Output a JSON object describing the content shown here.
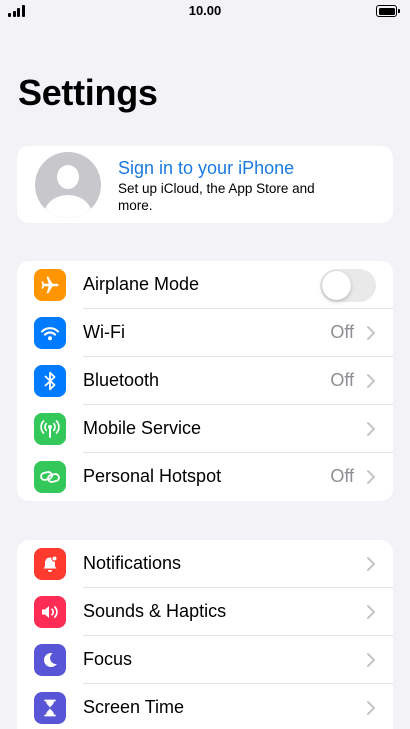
{
  "status_bar": {
    "time": "10.00",
    "signal_icon": "cellular-signal-icon",
    "battery_icon": "battery-full-icon"
  },
  "page": {
    "title": "Settings"
  },
  "profile": {
    "title": "Sign in to your iPhone",
    "subtitle": "Set up iCloud, the App Store and more.",
    "avatar_icon": "person-silhouette-icon",
    "title_color": "#1a7ae0"
  },
  "groups": [
    {
      "rows": [
        {
          "label": "Airplane Mode",
          "icon": "airplane-icon",
          "icon_color": "#ff9500",
          "control": "toggle",
          "toggle_on": false
        },
        {
          "label": "Wi-Fi",
          "icon": "wifi-icon",
          "icon_color": "#007aff",
          "value": "Off"
        },
        {
          "label": "Bluetooth",
          "icon": "bluetooth-icon",
          "icon_color": "#007aff",
          "value": "Off"
        },
        {
          "label": "Mobile Service",
          "icon": "antenna-icon",
          "icon_color": "#34c759",
          "value": ""
        },
        {
          "label": "Personal Hotspot",
          "icon": "hotspot-link-icon",
          "icon_color": "#34c759",
          "value": "Off"
        }
      ]
    },
    {
      "rows": [
        {
          "label": "Notifications",
          "icon": "bell-icon",
          "icon_color": "#ff3b30",
          "value": ""
        },
        {
          "label": "Sounds & Haptics",
          "icon": "speaker-icon",
          "icon_color": "#ff2d55",
          "value": ""
        },
        {
          "label": "Focus",
          "icon": "moon-icon",
          "icon_color": "#5856d6",
          "value": ""
        },
        {
          "label": "Screen Time",
          "icon": "hourglass-icon",
          "icon_color": "#5856d6",
          "value": ""
        }
      ]
    }
  ]
}
